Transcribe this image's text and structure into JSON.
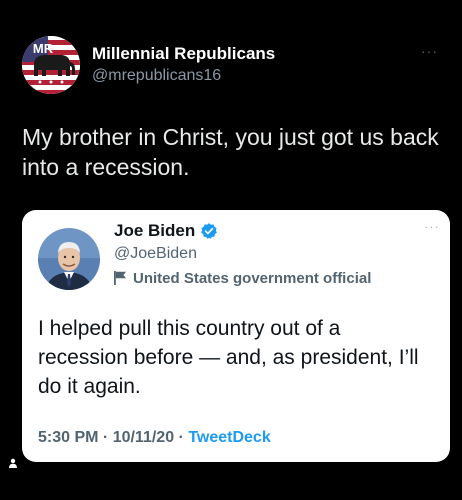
{
  "outer_tweet": {
    "display_name": "Millennial Republicans",
    "handle": "@mrepublicans16",
    "avatar_text": "MR",
    "text": "My brother in Christ, you just got us back into a recession.",
    "more_glyph": "···"
  },
  "quoted_tweet": {
    "display_name": "Joe Biden",
    "handle": "@JoeBiden",
    "gov_label": "United States government official",
    "text": "I helped pull this country out of a recession before — and, as president, I’ll do it again.",
    "time": "5:30 PM",
    "date": "10/11/20",
    "separator": " · ",
    "source": "TweetDeck",
    "more_glyph": "···"
  },
  "colors": {
    "background": "#000000",
    "card_background": "#ffffff",
    "verified_blue": "#1d9bf0",
    "link_blue": "#1d9bf0",
    "secondary_gray": "#536471",
    "handle_gray_dark": "#8b98a5",
    "flag_red": "#b22234",
    "flag_blue": "#3c3b6e"
  },
  "icons": {
    "verified": "verified-badge-icon",
    "government": "flag-icon",
    "more": "more-options-icon",
    "user": "user-icon"
  }
}
